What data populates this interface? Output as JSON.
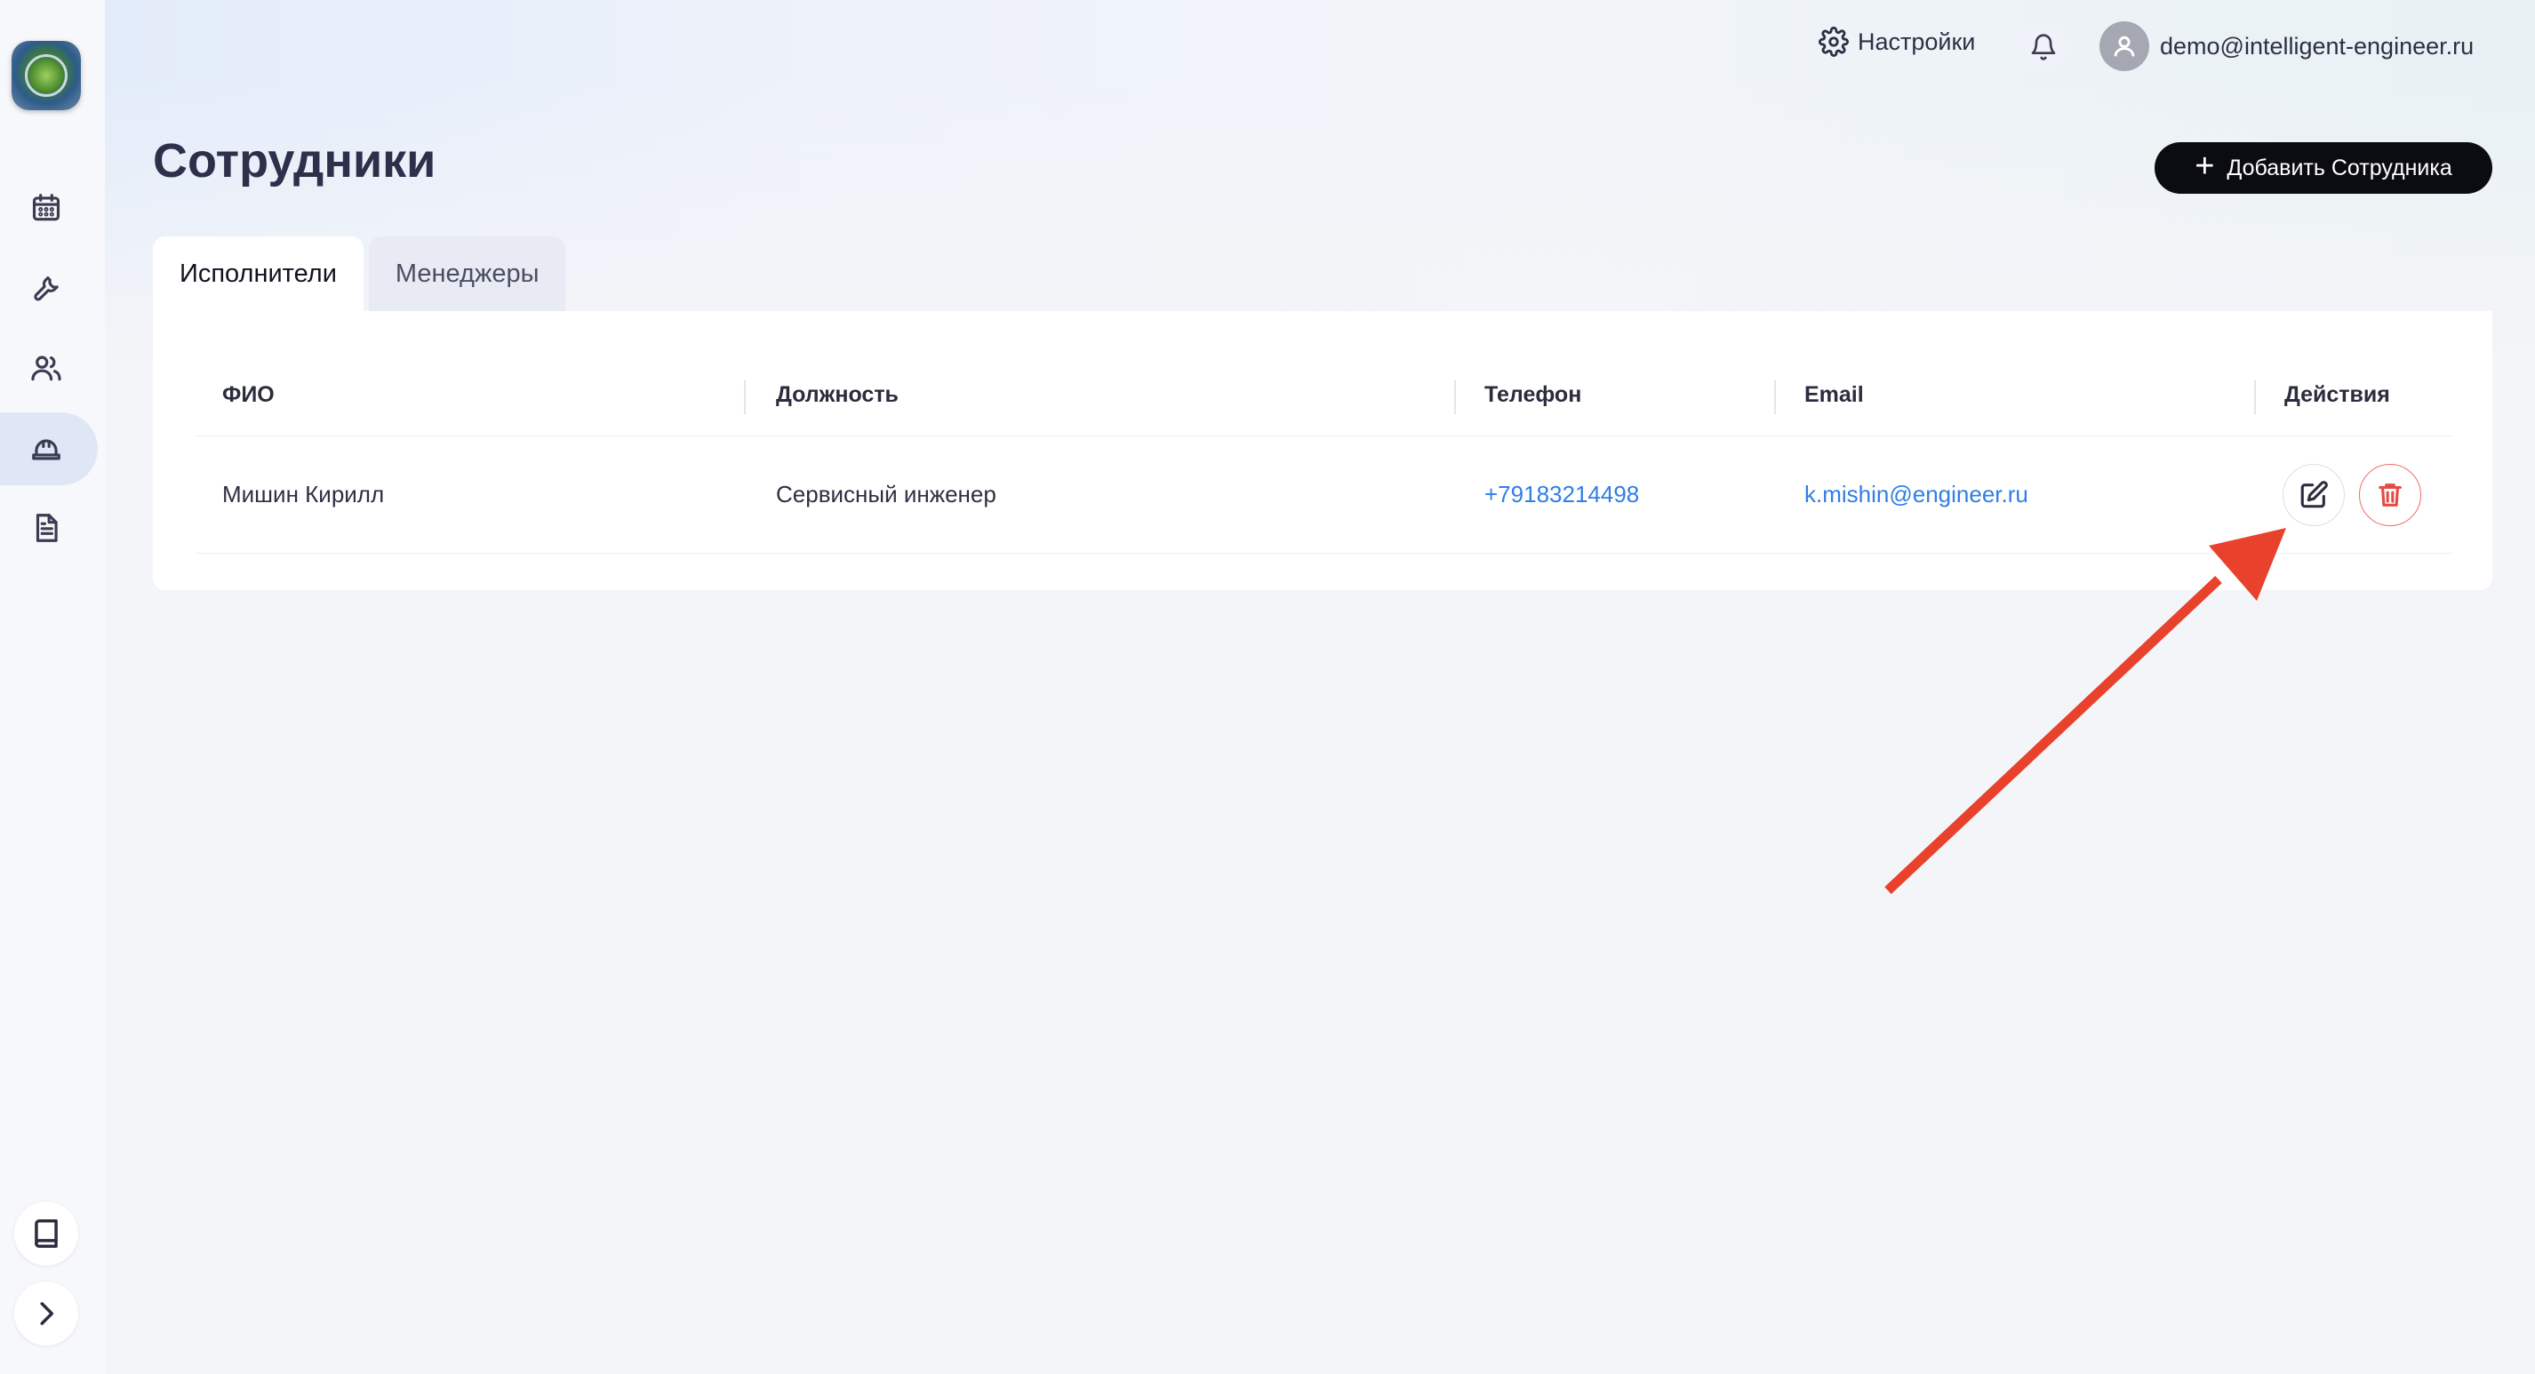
{
  "header": {
    "settings_label": "Настройки",
    "user_email": "demo@intelligent-engineer.ru"
  },
  "page": {
    "title": "Сотрудники",
    "add_button_label": "Добавить Сотрудника"
  },
  "tabs": [
    {
      "label": "Исполнители",
      "active": true
    },
    {
      "label": "Менеджеры",
      "active": false
    }
  ],
  "table": {
    "columns": [
      "ФИО",
      "Должность",
      "Телефон",
      "Email",
      "Действия"
    ],
    "rows": [
      {
        "name": "Мишин Кирилл",
        "position": "Сервисный инженер",
        "phone": "+79183214498",
        "email": "k.mishin@engineer.ru"
      }
    ]
  },
  "sidebar": {
    "items": [
      "calendar-icon",
      "wrench-icon",
      "users-icon",
      "hard-hat-icon",
      "document-icon"
    ],
    "active_item": "hard-hat-icon",
    "bottom": [
      "book-icon",
      "chevron-right-icon"
    ]
  },
  "colors": {
    "accent_link": "#2f7fe4",
    "delete": "#e64b45",
    "primary_button": "#0b0b12",
    "annotation_arrow": "#e8412c"
  }
}
